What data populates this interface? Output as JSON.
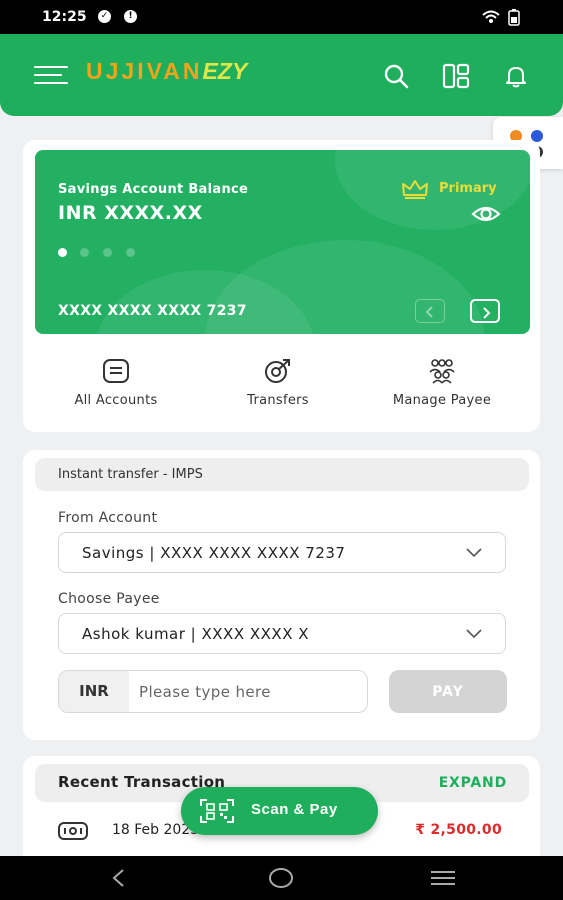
{
  "status_bar": {
    "time": "12:25",
    "icons": [
      "check-circle-icon",
      "alert-circle-icon",
      "wifi-icon",
      "battery-icon"
    ]
  },
  "header": {
    "logo_main": "UJJIVAN",
    "logo_suffix": "EZY",
    "icons": [
      "menu-icon",
      "search-icon",
      "dashboard-icon",
      "bell-icon"
    ],
    "colors": {
      "brand_green": "#1fae5b",
      "logo_orange": "#f5a31a"
    }
  },
  "app_switcher": {
    "icon": "apps-dots-icon",
    "dot_colors": [
      "#f08a24",
      "#2a5ad8",
      "#d92c2c",
      "#333333"
    ]
  },
  "account_card": {
    "balance_label": "Savings Account Balance",
    "balance_value": "INR XXXX.XX",
    "primary_label": "Primary",
    "account_number": "XXXX XXXX XXXX 7237",
    "pager": {
      "current": 1,
      "total": 4
    },
    "card_color": "#23b063"
  },
  "quick_actions": [
    {
      "label": "All Accounts",
      "icon": "accounts-icon"
    },
    {
      "label": "Transfers",
      "icon": "transfer-icon"
    },
    {
      "label": "Manage Payee",
      "icon": "payee-group-icon"
    }
  ],
  "imps": {
    "title": "Instant transfer - IMPS",
    "from_label": "From Account",
    "from_value": "Savings | XXXX XXXX XXXX 7237",
    "payee_label": "Choose Payee",
    "payee_value": "Ashok kumar | XXXX XXXX X",
    "currency": "INR",
    "amount_placeholder": "Please type here",
    "pay_label": "PAY"
  },
  "recent": {
    "title": "Recent Transaction",
    "expand_label": "EXPAND",
    "transactions": [
      {
        "date": "18 Feb 2023",
        "amount": "₹ 2,500.00",
        "icon": "bank-card-icon",
        "color": "#d92c2c"
      }
    ]
  },
  "scan_pay": {
    "label": "Scan & Pay",
    "icon": "qr-scan-icon"
  },
  "system_nav": {
    "icons": [
      "back-icon",
      "home-icon",
      "recents-icon"
    ]
  }
}
